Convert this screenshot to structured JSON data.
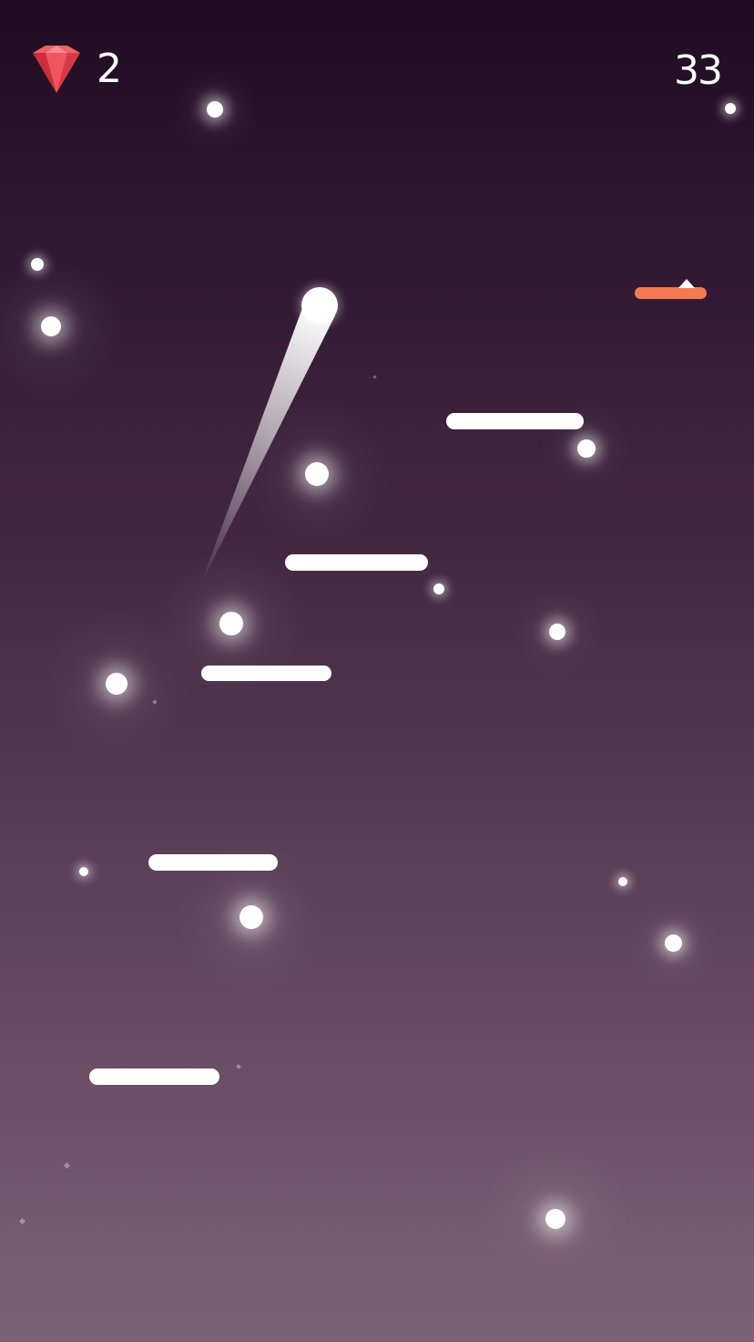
{
  "hud": {
    "gem_count": "2",
    "score": "33"
  },
  "colors": {
    "gem": "#e8404a",
    "platform": "#ffffff",
    "hazard_platform": "#f47a55",
    "player": "#ffffff",
    "background_top": "#200c22",
    "background_bottom": "#7d6277"
  },
  "icons": {
    "gem": "red-gem-icon"
  }
}
